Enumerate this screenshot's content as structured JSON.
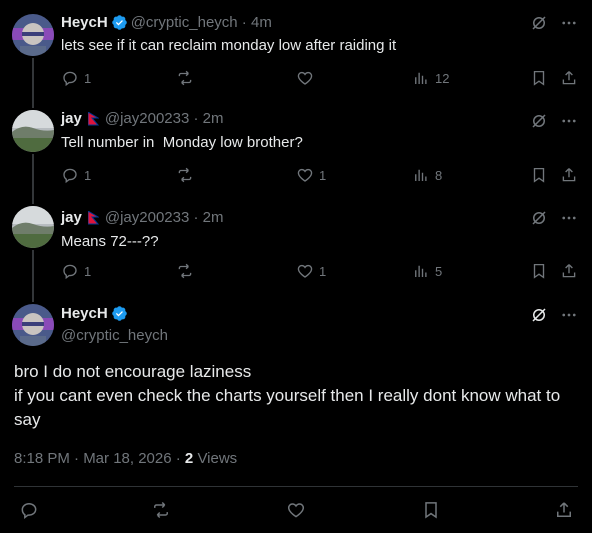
{
  "tweets": [
    {
      "name": "HeycH",
      "handle": "@cryptic_heych",
      "time": "4m",
      "text": "lets see if it can reclaim monday low after raiding it",
      "replies": "1",
      "reposts": "",
      "likes": "",
      "views": "12"
    },
    {
      "name": "jay",
      "handle": "@jay200233",
      "time": "2m",
      "text": "Tell number in  Monday low brother?",
      "replies": "1",
      "reposts": "",
      "likes": "1",
      "views": "8"
    },
    {
      "name": "jay",
      "handle": "@jay200233",
      "time": "2m",
      "text": "Means 72---??",
      "replies": "1",
      "reposts": "",
      "likes": "1",
      "views": "5"
    }
  ],
  "main": {
    "name": "HeycH",
    "handle": "@cryptic_heych",
    "line1": "bro I do not encourage laziness",
    "line2": "if you cant even check the charts yourself then I really dont know what to",
    "line3": "say",
    "date": "8:18 PM · Mar 18, 2026 · ",
    "views_count": "2",
    "views_label": "Views"
  },
  "separator": " · ",
  "colors": {
    "accent": "#1d9bf0",
    "muted": "#71767b",
    "text": "#e7e9ea",
    "bg": "#000000"
  }
}
